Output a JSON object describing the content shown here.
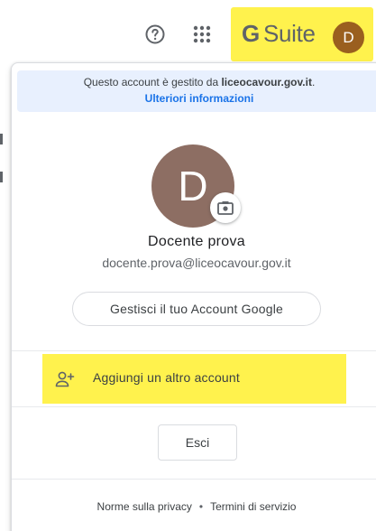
{
  "header": {
    "help_icon": "help-circle-icon",
    "apps_icon": "apps-grid-icon",
    "brand_g": "G",
    "brand_text": "Suite",
    "avatar_initial": "D",
    "highlight_color": "#fff24d"
  },
  "panel": {
    "managed_prefix": "Questo account è gestito da ",
    "managed_domain": "liceocavour.gov.it",
    "managed_suffix": ".",
    "more_info_link": "Ulteriori informazioni",
    "avatar_initial": "D",
    "avatar_color": "#8d6e63",
    "camera_icon": "camera-icon",
    "user_name": "Docente prova",
    "user_email": "docente.prova@liceocavour.gov.it",
    "manage_account_label": "Gestisci il tuo Account Google",
    "add_account_icon": "person-add-icon",
    "add_account_label": "Aggiungi un altro account",
    "sign_out_label": "Esci",
    "footer": {
      "privacy": "Norme sulla privacy",
      "separator": "•",
      "terms": "Termini di servizio"
    }
  }
}
